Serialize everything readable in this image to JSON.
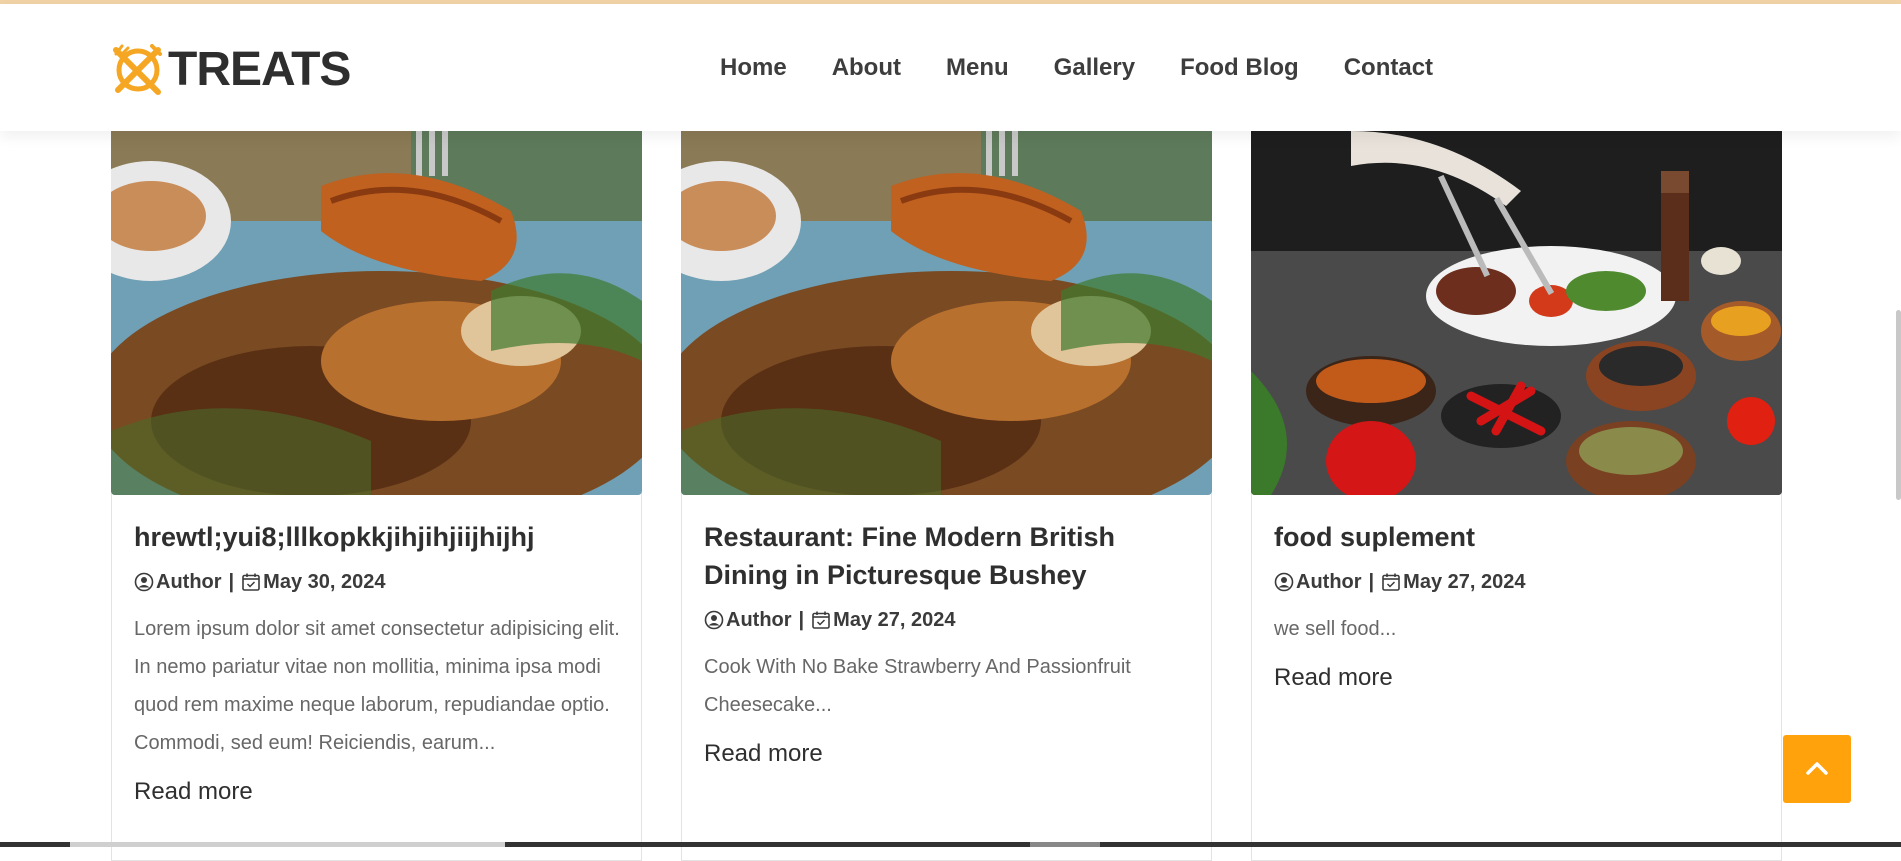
{
  "brand": {
    "name": "TREATS",
    "accent": "#f5a623"
  },
  "nav": [
    {
      "label": "Home"
    },
    {
      "label": "About"
    },
    {
      "label": "Menu"
    },
    {
      "label": "Gallery"
    },
    {
      "label": "Food Blog"
    },
    {
      "label": "Contact"
    }
  ],
  "posts": [
    {
      "title": "hrewtl;yui8;lllkopkkjihjihjiijhijhj",
      "author": "Author",
      "date": "May 30, 2024",
      "excerpt": "Lorem ipsum dolor sit amet consectetur adipisicing elit. In nemo pariatur vitae non mollitia, minima ipsa modi quod rem maxime neque laborum, repudiandae optio. Commodi, sed eum! Reiciendis, earum...",
      "read_more": "Read more",
      "image": "grilled-fish-on-fork"
    },
    {
      "title": "Restaurant: Fine Modern British Dining in Picturesque Bushey",
      "author": "Author",
      "date": "May 27, 2024",
      "excerpt": "Cook With No Bake Strawberry And Passionfruit Cheesecake...",
      "read_more": "Read more",
      "image": "grilled-fish-on-fork"
    },
    {
      "title": "food suplement",
      "author": "Author",
      "date": "May 27, 2024",
      "excerpt": "we sell food...",
      "read_more": "Read more",
      "image": "chef-plating-steak"
    }
  ],
  "meta_separator": "|",
  "icons": {
    "author": "user-circle-icon",
    "date": "calendar-check-icon",
    "scroll_top": "chevron-up-icon"
  }
}
